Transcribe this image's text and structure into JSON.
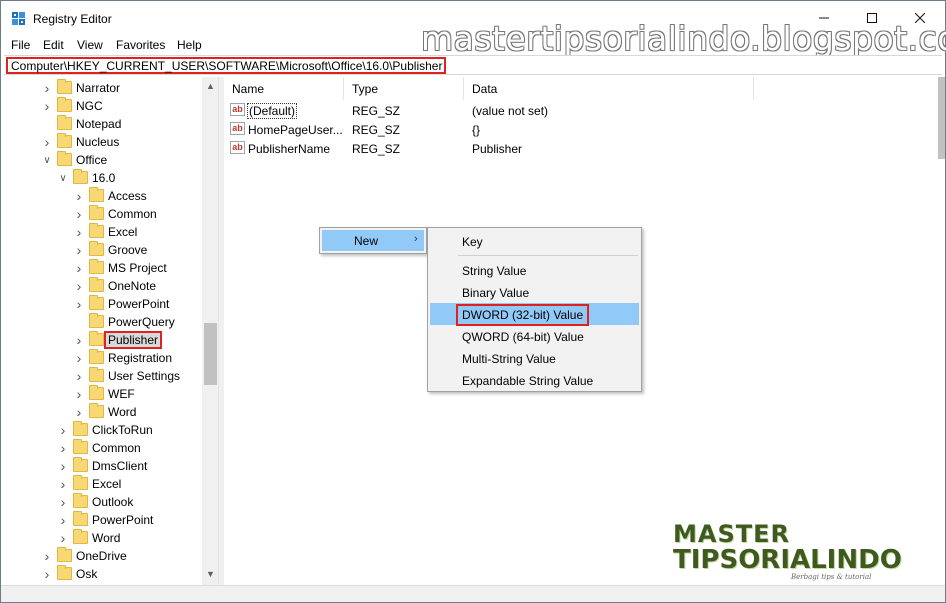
{
  "window": {
    "title": "Registry Editor",
    "watermark": "mastertipsorialindo.blogspot.com"
  },
  "menubar": {
    "items": [
      "File",
      "Edit",
      "View",
      "Favorites",
      "Help"
    ]
  },
  "address": {
    "path": "Computer\\HKEY_CURRENT_USER\\SOFTWARE\\Microsoft\\Office\\16.0\\Publisher"
  },
  "tree": {
    "items": [
      {
        "label": "Narrator",
        "expander": "collapsed",
        "depth": 0
      },
      {
        "label": "NGC",
        "expander": "collapsed",
        "depth": 0
      },
      {
        "label": "Notepad",
        "expander": "none",
        "depth": 0
      },
      {
        "label": "Nucleus",
        "expander": "collapsed",
        "depth": 0
      },
      {
        "label": "Office",
        "expander": "expanded",
        "depth": 0
      },
      {
        "label": "16.0",
        "expander": "expanded",
        "depth": 1
      },
      {
        "label": "Access",
        "expander": "collapsed",
        "depth": 2
      },
      {
        "label": "Common",
        "expander": "collapsed",
        "depth": 2
      },
      {
        "label": "Excel",
        "expander": "collapsed",
        "depth": 2
      },
      {
        "label": "Groove",
        "expander": "collapsed",
        "depth": 2
      },
      {
        "label": "MS Project",
        "expander": "collapsed",
        "depth": 2
      },
      {
        "label": "OneNote",
        "expander": "collapsed",
        "depth": 2
      },
      {
        "label": "PowerPoint",
        "expander": "collapsed",
        "depth": 2
      },
      {
        "label": "PowerQuery",
        "expander": "none",
        "depth": 2
      },
      {
        "label": "Publisher",
        "expander": "collapsed",
        "depth": 2,
        "selected": true
      },
      {
        "label": "Registration",
        "expander": "collapsed",
        "depth": 2
      },
      {
        "label": "User Settings",
        "expander": "collapsed",
        "depth": 2
      },
      {
        "label": "WEF",
        "expander": "collapsed",
        "depth": 2
      },
      {
        "label": "Word",
        "expander": "collapsed",
        "depth": 2
      },
      {
        "label": "ClickToRun",
        "expander": "collapsed",
        "depth": 1
      },
      {
        "label": "Common",
        "expander": "collapsed",
        "depth": 1
      },
      {
        "label": "DmsClient",
        "expander": "collapsed",
        "depth": 1
      },
      {
        "label": "Excel",
        "expander": "collapsed",
        "depth": 1
      },
      {
        "label": "Outlook",
        "expander": "collapsed",
        "depth": 1
      },
      {
        "label": "PowerPoint",
        "expander": "collapsed",
        "depth": 1
      },
      {
        "label": "Word",
        "expander": "collapsed",
        "depth": 1
      },
      {
        "label": "OneDrive",
        "expander": "collapsed",
        "depth": 0
      },
      {
        "label": "Osk",
        "expander": "collapsed",
        "depth": 0
      }
    ]
  },
  "values": {
    "columns": [
      "Name",
      "Type",
      "Data"
    ],
    "rows": [
      {
        "name": "(Default)",
        "type": "REG_SZ",
        "data": "(value not set)"
      },
      {
        "name": "HomePageUser...",
        "type": "REG_SZ",
        "data": "{}"
      },
      {
        "name": "PublisherName",
        "type": "REG_SZ",
        "data": "Publisher"
      }
    ]
  },
  "context_menu": {
    "new_label": "New",
    "submenu": [
      "Key",
      "String Value",
      "Binary Value",
      "DWORD (32-bit) Value",
      "QWORD (64-bit) Value",
      "Multi-String Value",
      "Expandable String Value"
    ],
    "highlighted": "DWORD (32-bit) Value"
  },
  "logo": {
    "line1": "MASTER",
    "line2": "TIPSORIALINDO",
    "tagline": "Berbagi tips & tutorial"
  },
  "colors": {
    "selection": "#91c9f7",
    "highlight_box": "#dd2222",
    "folder": "#f8d775"
  }
}
